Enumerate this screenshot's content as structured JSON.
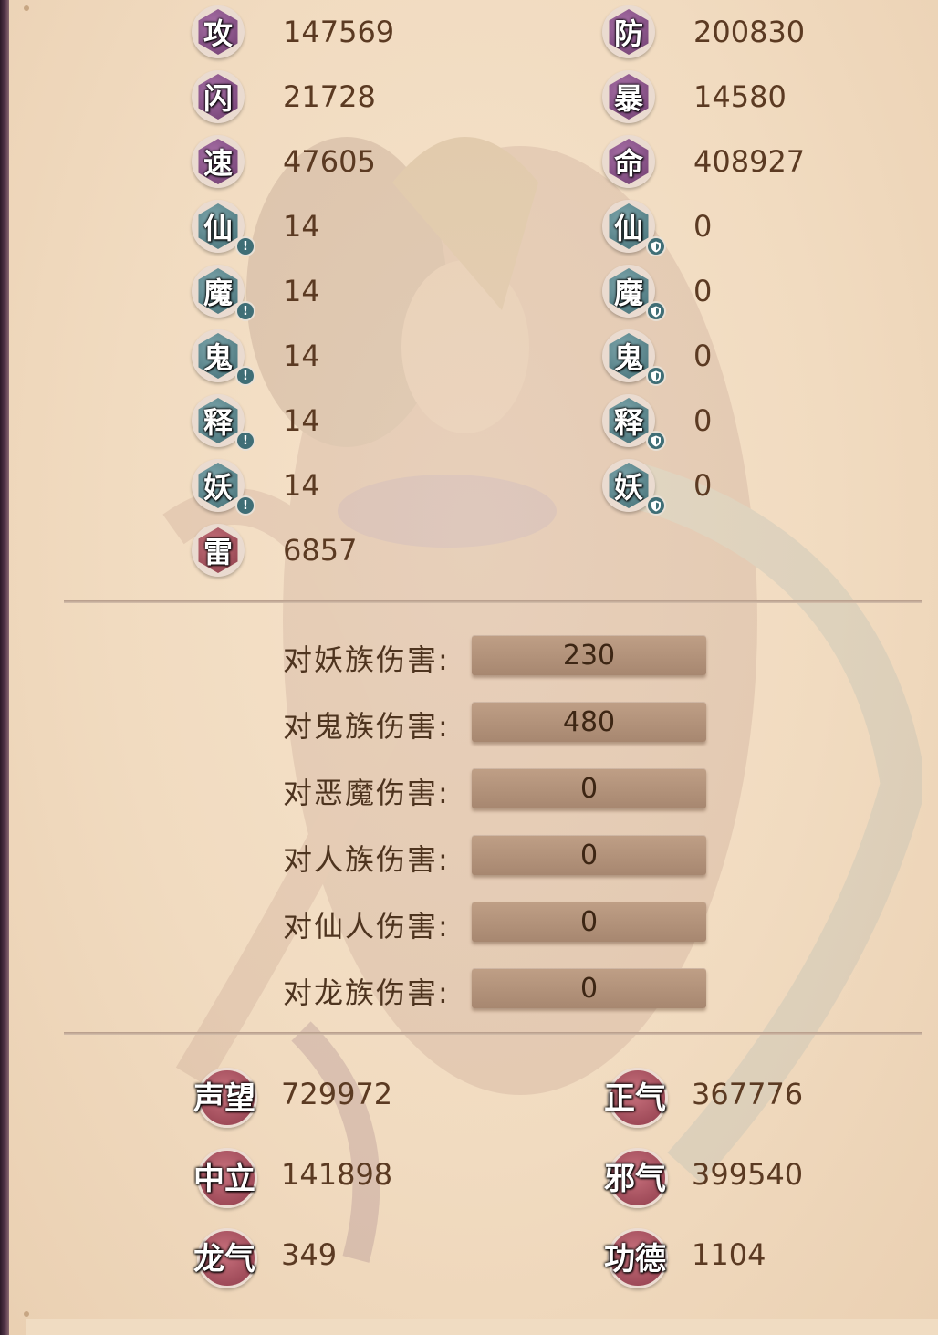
{
  "stats": {
    "left": [
      {
        "icon": "攻",
        "value": "147569",
        "style": "purple"
      },
      {
        "icon": "闪",
        "value": "21728",
        "style": "purple"
      },
      {
        "icon": "速",
        "value": "47605",
        "style": "purple"
      },
      {
        "icon": "仙",
        "value": "14",
        "style": "teal",
        "mini": "!"
      },
      {
        "icon": "魔",
        "value": "14",
        "style": "teal",
        "mini": "!"
      },
      {
        "icon": "鬼",
        "value": "14",
        "style": "teal",
        "mini": "!"
      },
      {
        "icon": "释",
        "value": "14",
        "style": "teal",
        "mini": "!"
      },
      {
        "icon": "妖",
        "value": "14",
        "style": "teal",
        "mini": "!"
      },
      {
        "icon": "雷",
        "value": "6857",
        "style": "red"
      }
    ],
    "right": [
      {
        "icon": "防",
        "value": "200830",
        "style": "purple"
      },
      {
        "icon": "暴",
        "value": "14580",
        "style": "purple"
      },
      {
        "icon": "命",
        "value": "408927",
        "style": "purple"
      },
      {
        "icon": "仙",
        "value": "0",
        "style": "teal",
        "mini": "shield"
      },
      {
        "icon": "魔",
        "value": "0",
        "style": "teal",
        "mini": "shield"
      },
      {
        "icon": "鬼",
        "value": "0",
        "style": "teal",
        "mini": "shield"
      },
      {
        "icon": "释",
        "value": "0",
        "style": "teal",
        "mini": "shield"
      },
      {
        "icon": "妖",
        "value": "0",
        "style": "teal",
        "mini": "shield"
      }
    ]
  },
  "damage": [
    {
      "label": "对妖族伤害:",
      "value": "230"
    },
    {
      "label": "对鬼族伤害:",
      "value": "480"
    },
    {
      "label": "对恶魔伤害:",
      "value": "0"
    },
    {
      "label": "对人族伤害:",
      "value": "0"
    },
    {
      "label": "对仙人伤害:",
      "value": "0"
    },
    {
      "label": "对龙族伤害:",
      "value": "0"
    }
  ],
  "reputation": {
    "left": [
      {
        "label": "声望",
        "value": "729972"
      },
      {
        "label": "中立",
        "value": "141898"
      },
      {
        "label": "龙气",
        "value": "349"
      }
    ],
    "right": [
      {
        "label": "正气",
        "value": "367776"
      },
      {
        "label": "邪气",
        "value": "399540"
      },
      {
        "label": "功德",
        "value": "1104"
      }
    ]
  },
  "colors": {
    "panel_bg": "#f1dbc0",
    "value_text": "#5b3a22",
    "purple_badge": "#7d4a7c",
    "teal_badge": "#4a7a81",
    "red_badge": "#9a4452",
    "damage_box": "#b0917a"
  },
  "icons": {
    "mini_warning": "exclamation-icon",
    "mini_shield": "shield-icon"
  }
}
